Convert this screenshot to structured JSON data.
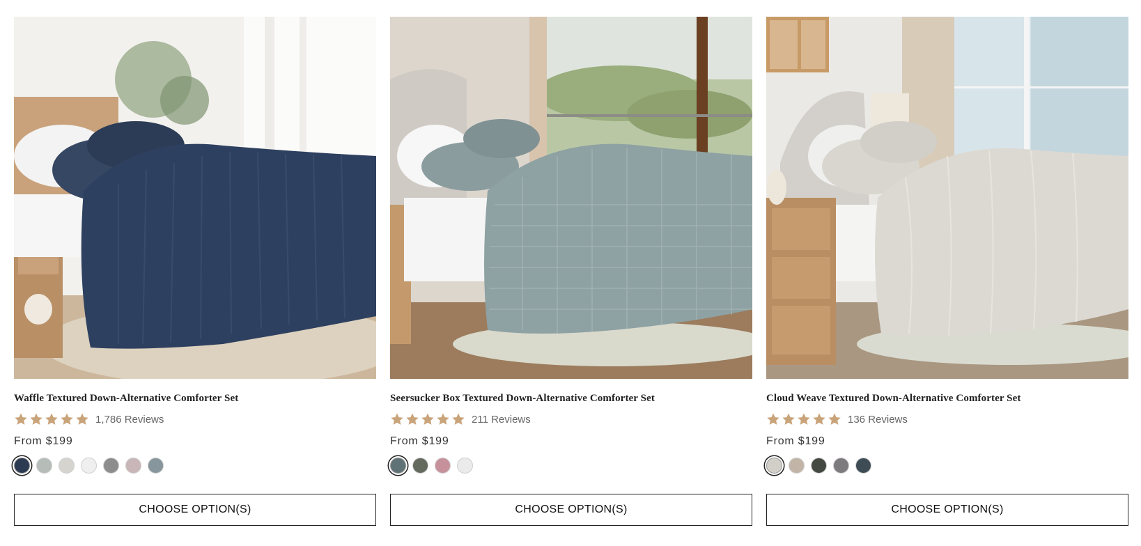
{
  "products": [
    {
      "title": "Waffle Textured Down-Alternative Comforter Set",
      "rating": 5,
      "reviews": "1,786 Reviews",
      "price": "From $199",
      "swatches": [
        "#2c3b52",
        "#b6bcb8",
        "#d6d4cf",
        "#efefef",
        "#8d8d8d",
        "#c8b6b8",
        "#87969c"
      ],
      "selected_swatch": 0,
      "button": "CHOOSE OPTION(S)",
      "image_icon": "navy-waffle-comforter-bed-photo",
      "comforter_color": "#2e4060"
    },
    {
      "title": "Seersucker Box Textured Down-Alternative Comforter Set",
      "rating": 5,
      "reviews": "211 Reviews",
      "price": "From $199",
      "swatches": [
        "#5f7276",
        "#646a5e",
        "#c7919c",
        "#ebebeb"
      ],
      "selected_swatch": 0,
      "button": "CHOOSE OPTION(S)",
      "image_icon": "sage-seersucker-comforter-bed-photo",
      "comforter_color": "#8ea1a3"
    },
    {
      "title": "Cloud Weave Textured Down-Alternative Comforter Set",
      "rating": 5,
      "reviews": "136 Reviews",
      "price": "From $199",
      "swatches": [
        "#d2cfc8",
        "#c2b5a8",
        "#444a42",
        "#7d7b7d",
        "#3e4c55"
      ],
      "selected_swatch": 0,
      "button": "CHOOSE OPTION(S)",
      "image_icon": "ivory-cloud-weave-comforter-bed-photo",
      "comforter_color": "#dcd9d2"
    }
  ],
  "star_color": "#c9a47a"
}
